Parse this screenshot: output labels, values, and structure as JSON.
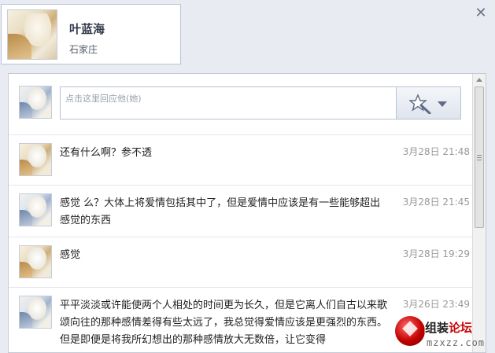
{
  "profile": {
    "name": "叶蓝海",
    "location": "石家庄"
  },
  "reply": {
    "placeholder": "点击这里回应他(她)"
  },
  "messages": [
    {
      "text": "还有什么啊？参不透",
      "time": "3月28日 21:48"
    },
    {
      "text": "感觉  么？大体上将爱情包括其中了，但是爱情中应该是有一些能够超出感觉的东西",
      "time": "3月28日 21:45"
    },
    {
      "text": "感觉",
      "time": "3月28日 19:29"
    },
    {
      "text": "平平淡淡或许能使两个人相处的时间更为长久，但是它离人们自古以来歌颂向往的那种感情差得有些太远了，我总觉得爱情应该是更强烈的东西。但是即便是将我所幻想出的那种感情放大无数倍，让它变得",
      "time": "3月26日 23:49"
    }
  ],
  "watermark": {
    "title_a": "组装",
    "title_b": "论坛",
    "site": "mzxzz.com"
  },
  "icons": {
    "close": "close-icon",
    "emote": "magic-wand-star-icon",
    "caret": "chevron-down-icon"
  },
  "colors": {
    "background": "#e8ebf2",
    "panel_border": "#c4cad6",
    "time_text": "#999999",
    "name_text": "#333a4a"
  }
}
